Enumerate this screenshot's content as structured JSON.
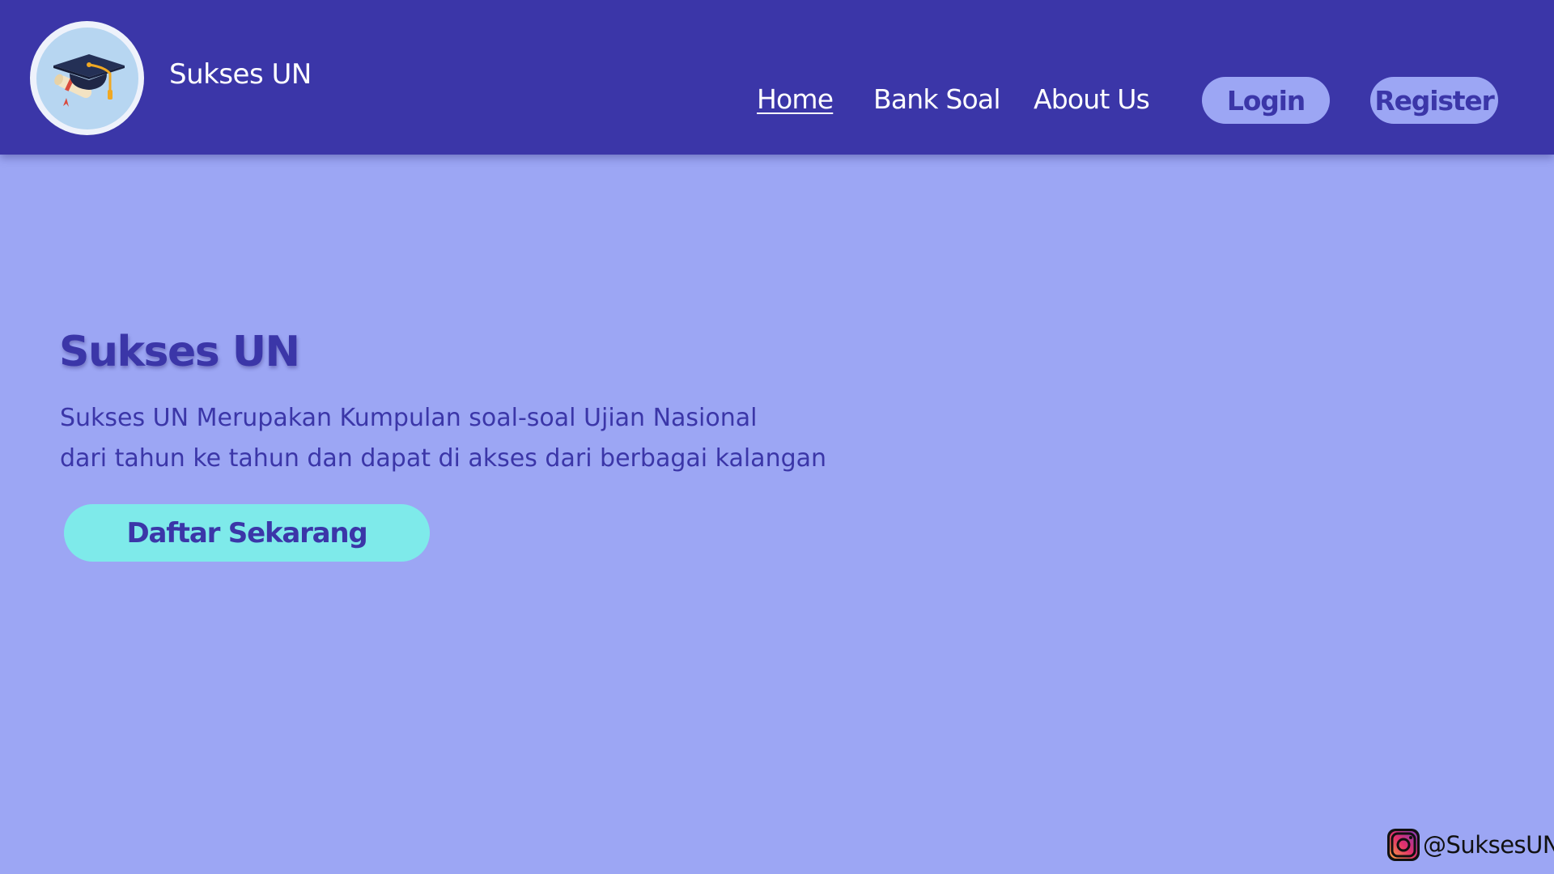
{
  "brand": {
    "name": "Sukses UN",
    "logo_icon": "graduation-cap-icon"
  },
  "nav": {
    "links": [
      {
        "label": "Home",
        "active": true
      },
      {
        "label": "Bank Soal",
        "active": false
      },
      {
        "label": "About Us",
        "active": false
      }
    ],
    "login_label": "Login",
    "register_label": "Register"
  },
  "hero": {
    "title": "Sukses UN",
    "description_lines": [
      "Sukses UN Merupakan Kumpulan soal-soal Ujian Nasional",
      "dari tahun ke tahun dan dapat di akses dari berbagai kalangan"
    ],
    "cta_label": "Daftar Sekarang"
  },
  "social": {
    "icon": "instagram-icon",
    "handle": "@SuksesUN"
  },
  "colors": {
    "navbar": "#3b36a8",
    "background": "#9ca6f4",
    "cta": "#7eeaea",
    "text_primary": "#3b36a8"
  }
}
